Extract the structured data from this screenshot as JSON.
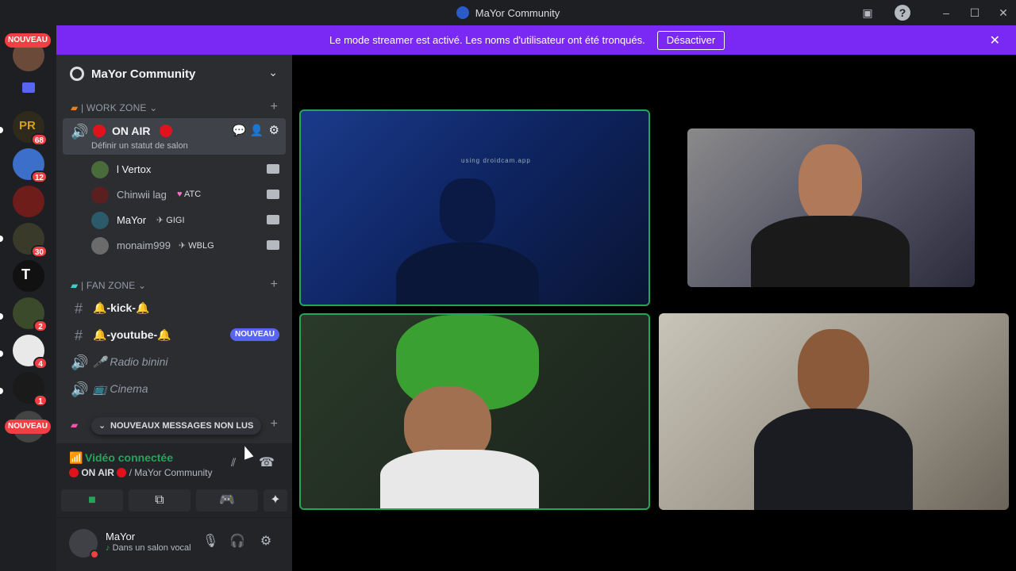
{
  "window": {
    "title": "MaYor Community"
  },
  "banner": {
    "text": "Le mode streamer est activé. Les noms d'utilisateur ont été tronqués.",
    "button": "Désactiver"
  },
  "guilds": {
    "top_badge": "NOUVEAU",
    "bottom_badge": "NOUVEAU",
    "items": [
      {
        "badge": ""
      },
      {
        "badge": "68"
      },
      {
        "badge": "12"
      },
      {
        "badge": ""
      },
      {
        "badge": "30"
      },
      {
        "badge": ""
      },
      {
        "badge": "2"
      },
      {
        "badge": "4"
      },
      {
        "badge": "1"
      }
    ]
  },
  "server": {
    "name": "MaYor Community",
    "categories": {
      "work": "| WORK ZONE",
      "fan": "| FAN ZONE",
      "third_plus": "+"
    },
    "active_channel": {
      "name": "ON AIR",
      "status": "Définir un statut de salon"
    },
    "voice_users": [
      {
        "name": "l Vertox",
        "tag": ""
      },
      {
        "name": "Chinwii lag",
        "tag": "ATC"
      },
      {
        "name": "MaYor",
        "tag": "GIGI"
      },
      {
        "name": "monaim999",
        "tag": "WBLG"
      }
    ],
    "channels": [
      {
        "name": "🔔-kick-🔔",
        "badge": ""
      },
      {
        "name": "🔔-youtube-🔔",
        "badge": "NOUVEAU"
      },
      {
        "name": "Radio binini",
        "badge": ""
      },
      {
        "name": "Cinema",
        "badge": ""
      }
    ],
    "unread_bar": "NOUVEAUX MESSAGES NON LUS"
  },
  "voice_panel": {
    "status": "Vidéo connectée",
    "channel_name": "ON AIR",
    "server_name": "/ MaYor Community"
  },
  "user": {
    "name": "MaYor",
    "status": "Dans un salon vocal"
  },
  "stage": {
    "watermark": "using droidcam.app"
  },
  "colors": {
    "accent_purple": "#7a29f4",
    "speaking_green": "#23a55a",
    "danger_red": "#f23f43",
    "badge_blue": "#5865f2"
  }
}
